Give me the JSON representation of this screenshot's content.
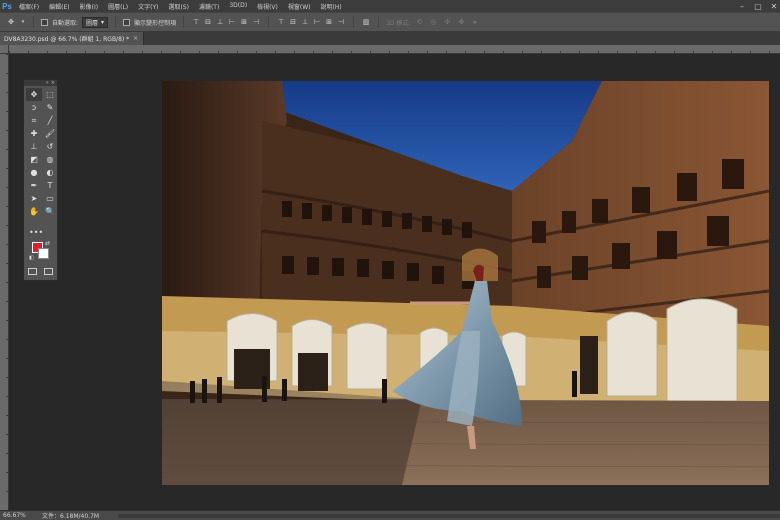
{
  "app": {
    "logo": "Ps",
    "menu": [
      "檔案(F)",
      "編輯(E)",
      "影像(I)",
      "圖層(L)",
      "文字(Y)",
      "選取(S)",
      "濾鏡(T)",
      "3D(D)",
      "檢視(V)",
      "視窗(W)",
      "說明(H)"
    ],
    "window_controls": [
      "minimize-icon",
      "maximize-icon",
      "close-icon"
    ]
  },
  "options_bar": {
    "tool_icon": "move-tool-icon",
    "auto_select_label": "自動選取:",
    "auto_select_value": "圖層",
    "transform_controls_label": "顯示變形控制項",
    "mode_3d_label": "3D 模式:",
    "align_icons": [
      "align-top-icon",
      "align-vcenter-icon",
      "align-bottom-icon",
      "align-left-icon",
      "align-hcenter-icon",
      "align-right-icon"
    ],
    "distribute_icons": [
      "distribute-top-icon",
      "distribute-vcenter-icon",
      "distribute-bottom-icon",
      "distribute-left-icon",
      "distribute-hcenter-icon",
      "distribute-right-icon"
    ]
  },
  "document": {
    "tab_title": "DV8A3230.psd @ 66.7% (群組 1, RGB/8) *",
    "tab_close": "×"
  },
  "tools": [
    {
      "name": "move-tool-icon",
      "glyph": "✥",
      "active": true
    },
    {
      "name": "marquee-tool-icon",
      "glyph": "⬚"
    },
    {
      "name": "lasso-tool-icon",
      "glyph": "ↄ"
    },
    {
      "name": "quick-select-tool-icon",
      "glyph": "✎"
    },
    {
      "name": "crop-tool-icon",
      "glyph": "⌗"
    },
    {
      "name": "eyedropper-tool-icon",
      "glyph": "╱"
    },
    {
      "name": "healing-brush-tool-icon",
      "glyph": "✚"
    },
    {
      "name": "brush-tool-icon",
      "glyph": "🖌"
    },
    {
      "name": "clone-stamp-tool-icon",
      "glyph": "⊥"
    },
    {
      "name": "history-brush-tool-icon",
      "glyph": "↺"
    },
    {
      "name": "eraser-tool-icon",
      "glyph": "◩"
    },
    {
      "name": "paint-bucket-tool-icon",
      "glyph": "◍"
    },
    {
      "name": "blur-tool-icon",
      "glyph": "●"
    },
    {
      "name": "dodge-tool-icon",
      "glyph": "◐"
    },
    {
      "name": "pen-tool-icon",
      "glyph": "✒"
    },
    {
      "name": "type-tool-icon",
      "glyph": "T"
    },
    {
      "name": "path-select-tool-icon",
      "glyph": "➤"
    },
    {
      "name": "shape-tool-icon",
      "glyph": "▭"
    },
    {
      "name": "hand-tool-icon",
      "glyph": "✋"
    },
    {
      "name": "zoom-tool-icon",
      "glyph": "🔍"
    }
  ],
  "tools_more": "•••",
  "colors": {
    "foreground": "#e51c23",
    "background": "#ffffff",
    "canvas_bg": "#282828",
    "panel_bg": "#535353"
  },
  "status": {
    "zoom": "66.67%",
    "doc_info": "文件：6.18M/40.7M",
    "arrow": "›"
  }
}
